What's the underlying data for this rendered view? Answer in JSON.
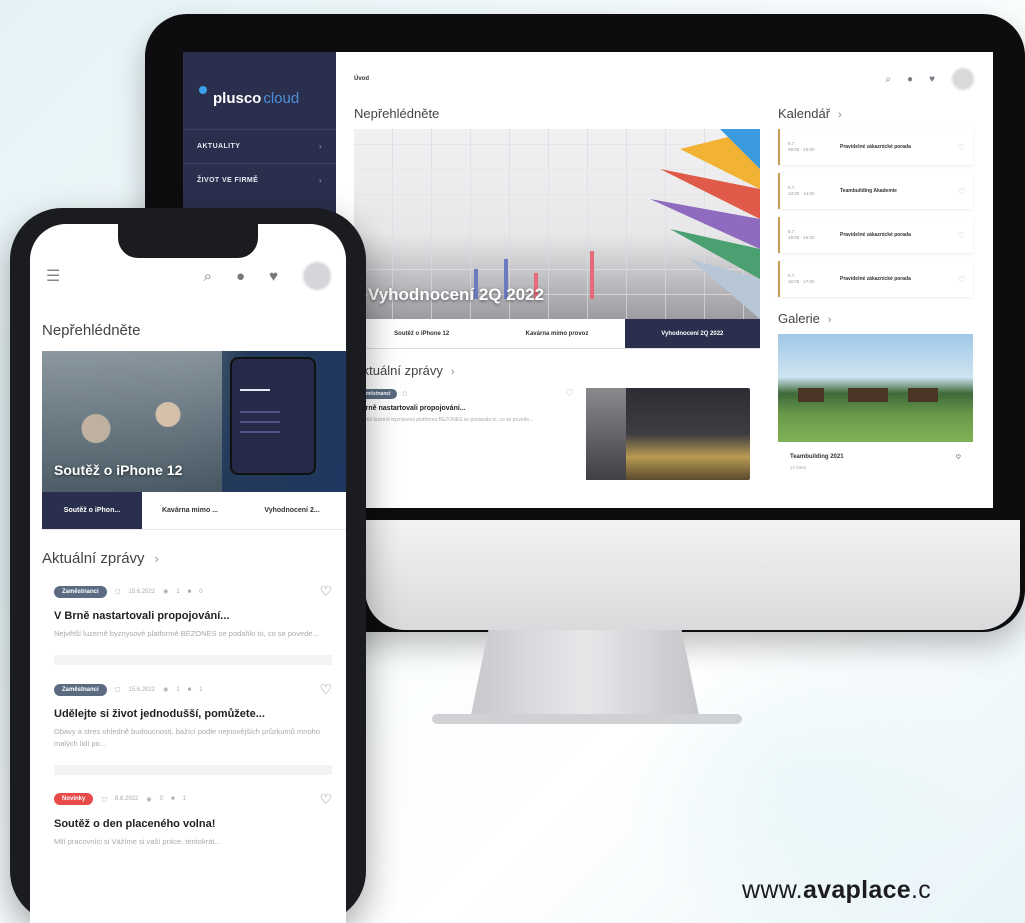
{
  "desktop": {
    "brand": {
      "name": "plusco",
      "suffix": "cloud"
    },
    "sidebar": {
      "items": [
        {
          "label": "AKTUALITY"
        },
        {
          "label": "ŽIVOT VE FIRMĚ"
        }
      ]
    },
    "breadcrumb": "Úvod",
    "section_featured": "Nepřehlédněte",
    "hero": {
      "title": "Vyhodnocení 2Q 2022"
    },
    "hero_tabs": [
      {
        "label": "Soutěž o iPhone 12"
      },
      {
        "label": "Kavárna mimo provoz"
      },
      {
        "label": "Vyhodnocení 2Q 2022"
      }
    ],
    "section_news": "Aktuální zprávy",
    "news": [
      {
        "badge": "Zaměstnanci",
        "title": "V Brně nastartovali propojování...",
        "excerpt": "Největší luzerně byznysová platforma BEZONES se postarala to, co se povede..."
      }
    ],
    "section_calendar": "Kalendář",
    "calendar": [
      {
        "date": "6.7.",
        "time": "09:00 - 10:00",
        "name": "Pravidelné zákaznické porada"
      },
      {
        "date": "6.7.",
        "time": "13:00 - 14:00",
        "name": "Teambuilding Akademie"
      },
      {
        "date": "6.7.",
        "time": "15:00 - 16:00",
        "name": "Pravidelné zákaznické porada"
      },
      {
        "date": "6.7.",
        "time": "16:00 - 17:00",
        "name": "Pravidelné zákaznické porada"
      }
    ],
    "section_gallery": "Galerie",
    "gallery": {
      "caption": "Teambuilding 2021",
      "sub": "12 fotek"
    }
  },
  "phone": {
    "section_featured": "Nepřehlédněte",
    "hero": {
      "title": "Soutěž o iPhone 12"
    },
    "tabs": [
      {
        "label": "Soutěž o iPhon..."
      },
      {
        "label": "Kavárna mimo ..."
      },
      {
        "label": "Vyhodnocení 2..."
      }
    ],
    "section_news": "Aktuální zprávy",
    "news": [
      {
        "badge": "Zaměstnanci",
        "badge_color": "#5b6b82",
        "date": "15.6.2022",
        "views": "1",
        "comments": "0",
        "title": "V Brně nastartovali propojování...",
        "excerpt": "Největší luzerně byznysové platformě BEZONES se podařilo to, co se povede..."
      },
      {
        "badge": "Zaměstnanci",
        "badge_color": "#5b6b82",
        "date": "15.6.2022",
        "views": "1",
        "comments": "1",
        "title": "Udělejte si život jednodušší, pomůžete...",
        "excerpt": "Obavy a stres ohledně budoucnosti, bažící podle nejnovějších průzkumů mnoho malých lidí po..."
      },
      {
        "badge": "Novinky",
        "badge_color": "#e84a4a",
        "date": "8.6.2022",
        "views": "0",
        "comments": "1",
        "title": "Soutěž o den placeného volna!",
        "excerpt": "Milí pracovníci si Vážíme si vaší práce, tentokrát..."
      }
    ]
  },
  "footer": {
    "url_prefix": "www.",
    "url_bold": "avaplace",
    "url_suffix": ".c"
  }
}
